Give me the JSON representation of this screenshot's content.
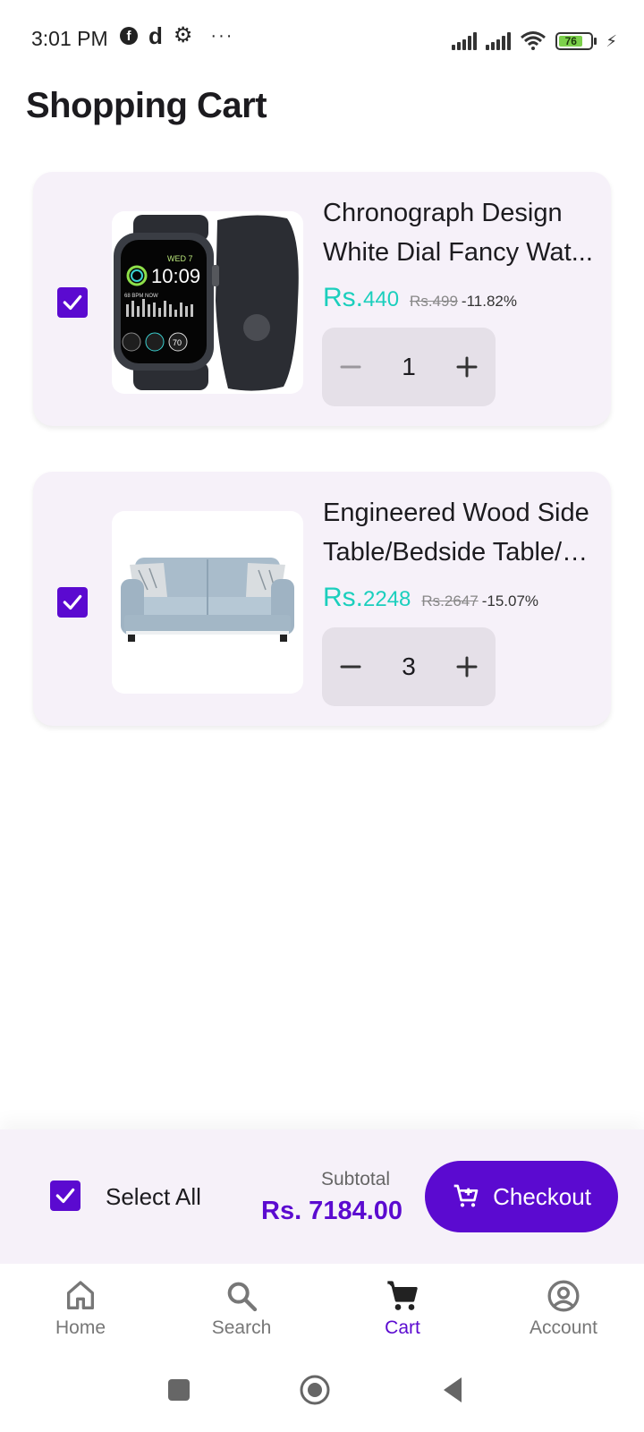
{
  "status_bar": {
    "time": "3:01 PM",
    "app_letter": "d",
    "more": "···",
    "battery": "76"
  },
  "page": {
    "title": "Shopping Cart"
  },
  "cart_items": [
    {
      "title_line1": "Chronograph Design",
      "title_line2": "White Dial Fancy Wat...",
      "currency": "Rs.",
      "price": "440",
      "old_price": "Rs.499",
      "discount": "-11.82%",
      "quantity": "1",
      "checked": true,
      "image": "smartwatch-image"
    },
    {
      "title_line1": "Engineered Wood Side",
      "title_line2": "Table/Bedside Table/S...",
      "currency": "Rs.",
      "price": "2248",
      "old_price": "Rs.2647",
      "discount": "-15.07%",
      "quantity": "3",
      "checked": true,
      "image": "sofa-image"
    }
  ],
  "checkout": {
    "select_all_label": "Select All",
    "subtotal_label": "Subtotal",
    "subtotal_value": "Rs. 7184.00",
    "checkout_label": "Checkout"
  },
  "bottom_nav": [
    {
      "label": "Home",
      "icon": "home-icon",
      "active": false
    },
    {
      "label": "Search",
      "icon": "search-icon",
      "active": false
    },
    {
      "label": "Cart",
      "icon": "cart-icon",
      "active": true
    },
    {
      "label": "Account",
      "icon": "account-icon",
      "active": false
    }
  ],
  "colors": {
    "primary": "#5b0ad0",
    "price": "#1bcfbd",
    "card_bg": "#f6f1f9",
    "stepper_bg": "#e5e0e8"
  }
}
